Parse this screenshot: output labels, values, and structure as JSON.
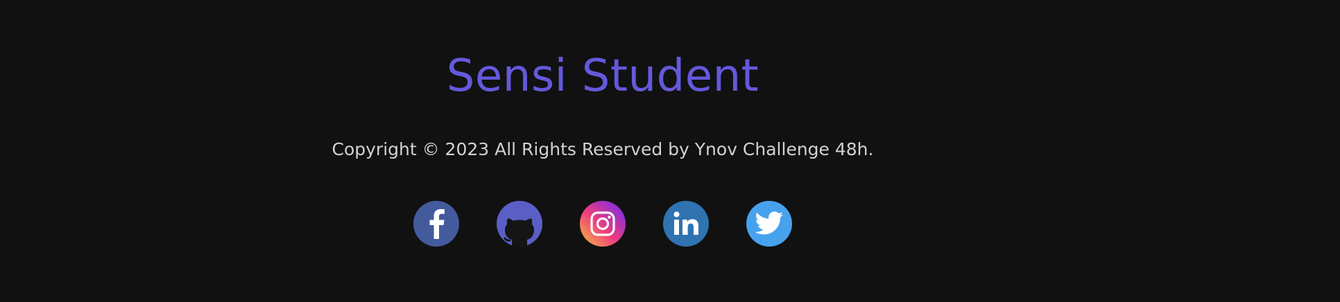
{
  "footer": {
    "brand": "Sensi Student",
    "copyright": "Copyright © 2023 All Rights Reserved by Ynov Challenge 48h.",
    "socials": [
      {
        "name": "facebook",
        "icon": "facebook-icon",
        "color": "#435b9d"
      },
      {
        "name": "github",
        "icon": "github-icon",
        "color": "#5b5fc5"
      },
      {
        "name": "instagram",
        "icon": "instagram-icon",
        "color": "#d6368a"
      },
      {
        "name": "linkedin",
        "icon": "linkedin-icon",
        "color": "#2f73b1"
      },
      {
        "name": "twitter",
        "icon": "twitter-icon",
        "color": "#47a2ee"
      }
    ]
  },
  "colors": {
    "background": "#111111",
    "brand": "#6459dc",
    "text": "#d2d2d2"
  }
}
